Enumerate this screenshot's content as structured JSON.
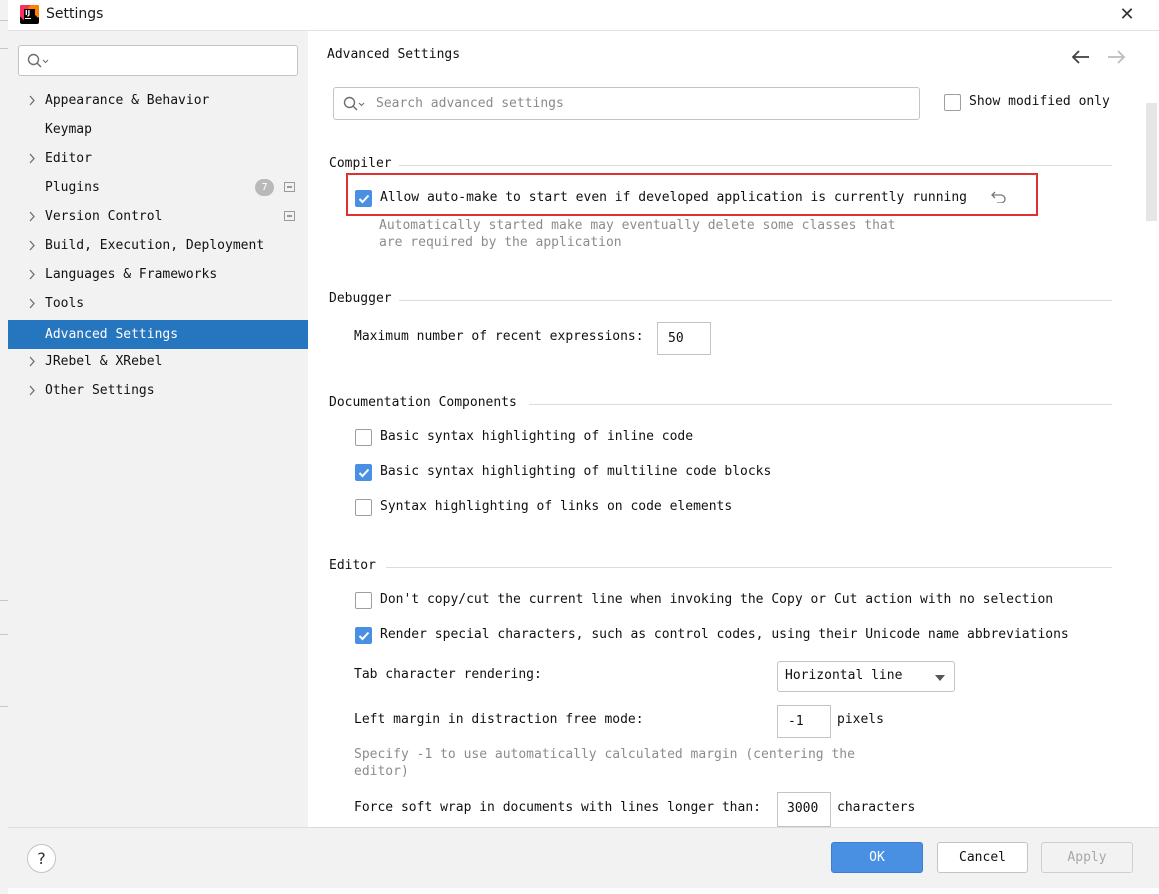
{
  "window": {
    "title": "Settings"
  },
  "sidebar": {
    "search_placeholder": "",
    "items": [
      {
        "label": "Appearance & Behavior",
        "expandable": true
      },
      {
        "label": "Keymap",
        "expandable": false
      },
      {
        "label": "Editor",
        "expandable": true
      },
      {
        "label": "Plugins",
        "expandable": false,
        "badge": "7"
      },
      {
        "label": "Version Control",
        "expandable": true
      },
      {
        "label": "Build, Execution, Deployment",
        "expandable": true
      },
      {
        "label": "Languages & Frameworks",
        "expandable": true
      },
      {
        "label": "Tools",
        "expandable": true
      },
      {
        "label": "Advanced Settings",
        "expandable": false,
        "selected": true
      },
      {
        "label": "JRebel & XRebel",
        "expandable": true
      },
      {
        "label": "Other Settings",
        "expandable": true
      }
    ]
  },
  "main": {
    "title": "Advanced Settings",
    "search_placeholder": "Search advanced settings",
    "show_modified_only": "Show modified only",
    "compiler": {
      "title": "Compiler",
      "auto_make_label": "Allow auto-make to start even if developed application is currently running",
      "auto_make_hint_1": "Automatically started make may eventually delete some classes that",
      "auto_make_hint_2": "are required by the application"
    },
    "debugger": {
      "title": "Debugger",
      "max_recent_label": "Maximum number of recent expressions:",
      "max_recent_value": "50"
    },
    "documentation": {
      "title": "Documentation Components",
      "inline_code_label": "Basic syntax highlighting of inline code",
      "multiline_label": "Basic syntax highlighting of multiline code blocks",
      "links_label": "Syntax highlighting of links on code elements"
    },
    "editor": {
      "title": "Editor",
      "copy_cut_label": "Don't copy/cut the current line when invoking the Copy or Cut action with no selection",
      "render_special_label": "Render special characters, such as control codes, using their Unicode name abbreviations",
      "tab_rendering_label": "Tab character rendering:",
      "tab_rendering_value": "Horizontal line",
      "left_margin_label": "Left margin in distraction free mode:",
      "left_margin_value": "-1",
      "left_margin_unit": "pixels",
      "left_margin_hint_1": "Specify -1 to use automatically calculated margin (centering the",
      "left_margin_hint_2": "editor)",
      "soft_wrap_label": "Force soft wrap in documents with lines longer than:",
      "soft_wrap_value": "3000",
      "soft_wrap_unit": "characters"
    }
  },
  "footer": {
    "help": "?",
    "ok": "OK",
    "cancel": "Cancel",
    "apply": "Apply"
  },
  "colors": {
    "accent": "#4a90e2",
    "selection": "#2675bf",
    "highlight_border": "#e03131"
  }
}
